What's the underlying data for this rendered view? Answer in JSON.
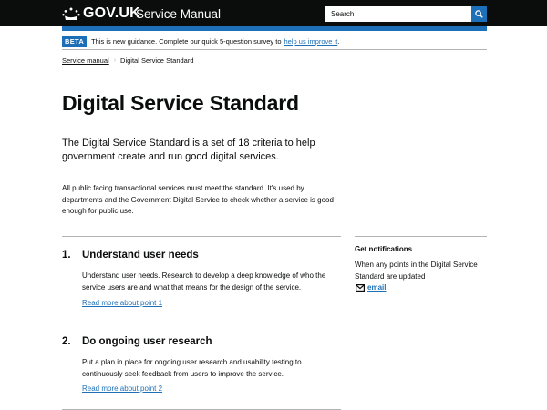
{
  "header": {
    "logo_text": "GOV.UK",
    "service_name": "Service Manual",
    "search_placeholder": "Search",
    "colors": {
      "background": "#0b0c0c",
      "accent": "#1d70b8"
    }
  },
  "beta_banner": {
    "tag": "BETA",
    "text": "This is new guidance. Complete our quick 5-question survey to",
    "link": "help us improve it",
    "suffix": "."
  },
  "breadcrumb": {
    "link": "Service manual",
    "current": "Digital Service Standard"
  },
  "main": {
    "title": "Digital Service Standard",
    "lead": "The Digital Service Standard is a set of 18 criteria to help government create and run good digital services.",
    "body": "All public facing transactional services must meet the standard. It's used by departments and the Government Digital Service to check whether a service is good enough for public use.",
    "points": [
      {
        "number": "1.",
        "title": "Understand user needs",
        "description": "Understand user needs. Research to develop a deep knowledge of who the service users are and what that means for the design of the service.",
        "link": "Read more about point 1"
      },
      {
        "number": "2.",
        "title": "Do ongoing user research",
        "description": "Put a plan in place for ongoing user research and usability testing to continuously seek feedback from users to improve the service.",
        "link": "Read more about point 2"
      }
    ]
  },
  "sidebar": {
    "title": "Get notifications",
    "text": "When any points in the Digital Service Standard are updated",
    "email_link": "email"
  }
}
